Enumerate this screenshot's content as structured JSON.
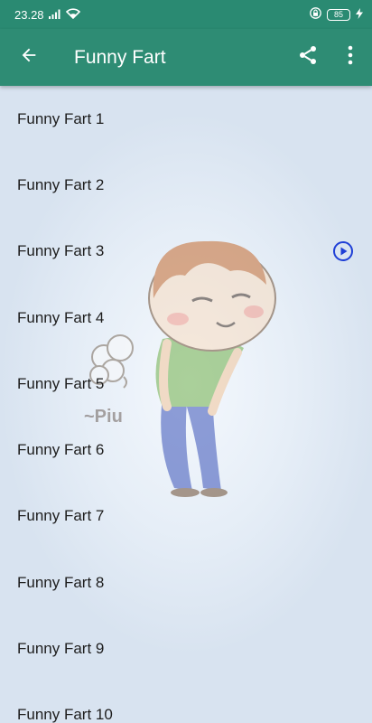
{
  "status_bar": {
    "time": "23.28",
    "battery_level": "85"
  },
  "app_bar": {
    "title": "Funny Fart",
    "back_icon": "arrow-back-icon",
    "share_icon": "share-icon",
    "menu_icon": "more-vert-icon"
  },
  "list": {
    "items": [
      {
        "label": "Funny Fart 1",
        "playing": false
      },
      {
        "label": "Funny Fart 2",
        "playing": false
      },
      {
        "label": "Funny Fart 3",
        "playing": true
      },
      {
        "label": "Funny Fart 4",
        "playing": false
      },
      {
        "label": "Funny Fart 5",
        "playing": false
      },
      {
        "label": "Funny Fart 6",
        "playing": false
      },
      {
        "label": "Funny Fart 7",
        "playing": false
      },
      {
        "label": "Funny Fart 8",
        "playing": false
      },
      {
        "label": "Funny Fart 9",
        "playing": false
      },
      {
        "label": "Funny Fart 10",
        "playing": false
      }
    ],
    "play_icon": "play-circle-icon"
  },
  "illustration": {
    "caption": "~Piu"
  },
  "colors": {
    "app_bar": "#2e8c74",
    "status_bar": "#2a8a72",
    "accent_play": "#1f3fd6",
    "background": "#dfe8f3"
  }
}
